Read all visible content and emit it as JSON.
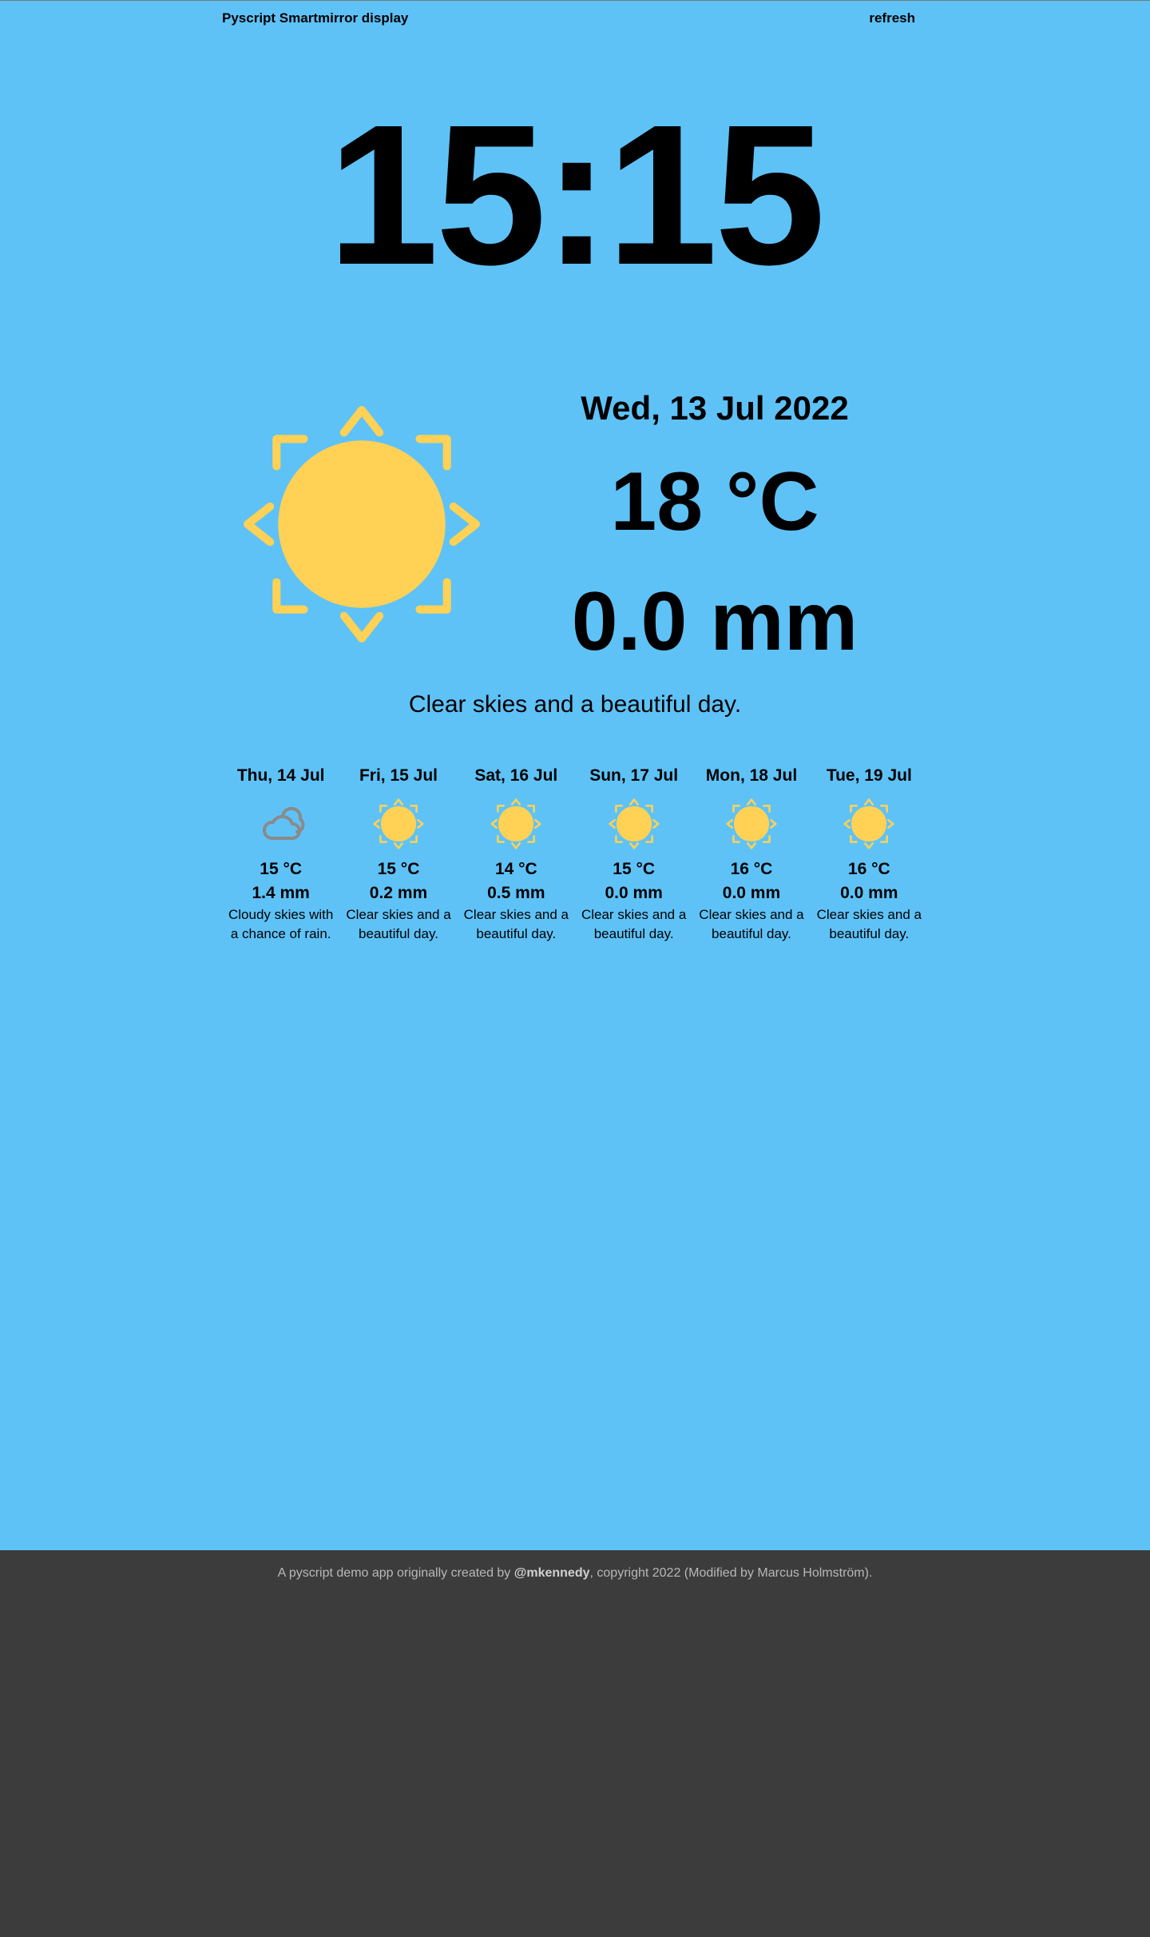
{
  "header": {
    "title": "Pyscript Smartmirror display",
    "refresh_label": "refresh"
  },
  "clock": {
    "time": "15:15"
  },
  "today": {
    "icon": "sun-icon",
    "date": "Wed, 13 Jul 2022",
    "temperature": "18 °C",
    "precipitation": "0.0 mm",
    "summary": "Clear skies and a beautiful day."
  },
  "forecast": [
    {
      "day": "Thu, 14 Jul",
      "icon": "cloud-icon",
      "temperature": "15 °C",
      "precipitation": "1.4 mm",
      "description": "Cloudy skies with a chance of rain."
    },
    {
      "day": "Fri, 15 Jul",
      "icon": "sun-icon",
      "temperature": "15 °C",
      "precipitation": "0.2 mm",
      "description": "Clear skies and a beautiful day."
    },
    {
      "day": "Sat, 16 Jul",
      "icon": "sun-icon",
      "temperature": "14 °C",
      "precipitation": "0.5 mm",
      "description": "Clear skies and a beautiful day."
    },
    {
      "day": "Sun, 17 Jul",
      "icon": "sun-icon",
      "temperature": "15 °C",
      "precipitation": "0.0 mm",
      "description": "Clear skies and a beautiful day."
    },
    {
      "day": "Mon, 18 Jul",
      "icon": "sun-icon",
      "temperature": "16 °C",
      "precipitation": "0.0 mm",
      "description": "Clear skies and a beautiful day."
    },
    {
      "day": "Tue, 19 Jul",
      "icon": "sun-icon",
      "temperature": "16 °C",
      "precipitation": "0.0 mm",
      "description": "Clear skies and a beautiful day."
    }
  ],
  "footer": {
    "prefix": "A pyscript demo app originally created by ",
    "author": "@mkennedy",
    "suffix": ", copyright 2022 (Modified by Marcus Holmström)."
  },
  "colors": {
    "background": "#5ec2f7",
    "footer_background": "#3c3c3c",
    "sun": "#ffd155",
    "cloud": "#8a8a8a"
  }
}
